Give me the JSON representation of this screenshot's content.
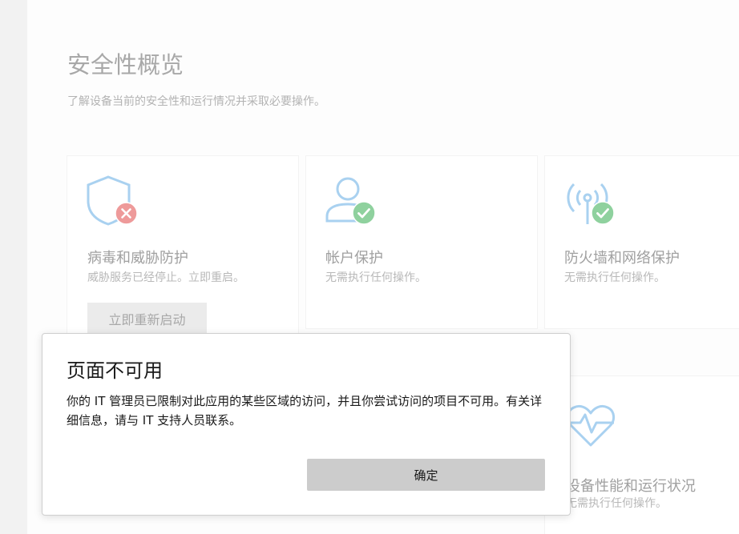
{
  "page": {
    "title": "安全性概览",
    "subtitle": "了解设备当前的安全性和运行情况并采取必要操作。"
  },
  "cards": [
    {
      "title": "病毒和威胁防护",
      "status": "威胁服务已经停止。立即重启。",
      "icon": "shield-icon",
      "badge": "error-badge-icon",
      "button_label": "立即重新启动"
    },
    {
      "title": "帐户保护",
      "status": "无需执行任何操作。",
      "icon": "person-icon",
      "badge": "check-badge-icon"
    },
    {
      "title": "防火墙和网络保护",
      "status": "无需执行任何操作。",
      "icon": "antenna-icon",
      "badge": "check-badge-icon"
    },
    {
      "title": "设备性能和运行状况",
      "status": "无需执行任何操作。",
      "icon": "heart-pulse-icon"
    }
  ],
  "dialog": {
    "title": "页面不可用",
    "message": "你的 IT 管理员已限制对此应用的某些区域的访问，并且你尝试访问的项目不可用。有关详细信息，请与 IT 支持人员联系。",
    "ok_label": "确定"
  },
  "colors": {
    "icon_blue": "#a9d1f0",
    "success_green": "#8fd19e",
    "error_red": "#ee9a9a"
  }
}
